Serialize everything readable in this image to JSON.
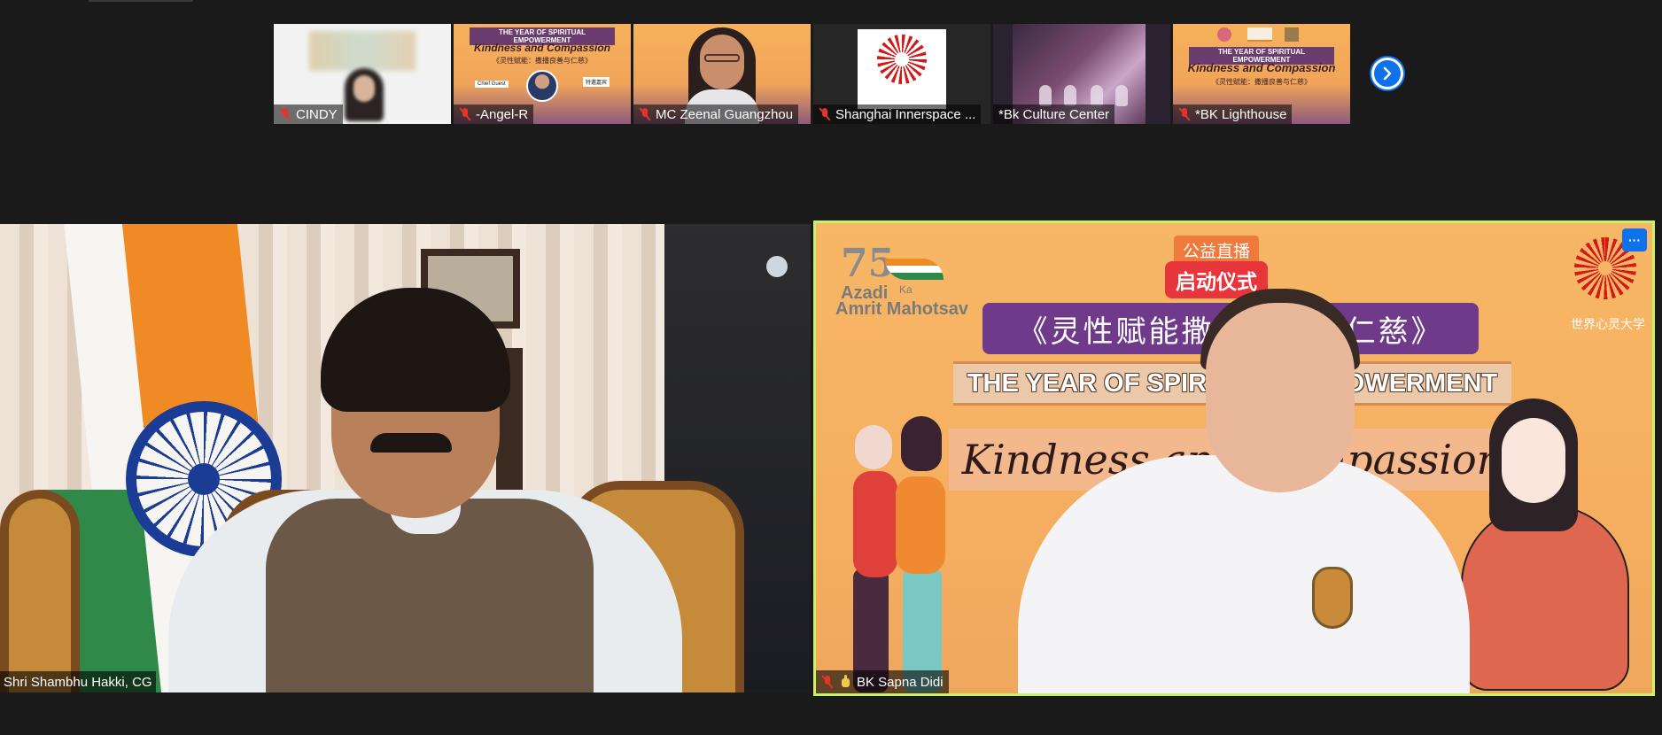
{
  "participants": [
    {
      "name": "CINDY",
      "muted": true
    },
    {
      "name": "-Angel-R",
      "muted": true
    },
    {
      "name": "MC Zeenal Guangzhou",
      "muted": true
    },
    {
      "name": "Shanghai Innerspace ...",
      "muted": true
    },
    {
      "name": "*Bk Culture Center",
      "muted": false
    },
    {
      "name": "*BK Lighthouse",
      "muted": true
    }
  ],
  "thumb_poster": {
    "title": "THE YEAR OF SPIRITUAL EMPOWERMENT",
    "subtitle": "Kindness and Compassion",
    "cn": "《灵性赋能：撒播良善与仁慈》",
    "chip_left": "Chief Guest",
    "chip_right": "特邀嘉宾"
  },
  "next_page_icon": "chevron-right-icon",
  "main_left": {
    "name": "Shri Shambhu Hakki, CG"
  },
  "main_right": {
    "name": "BK Sapna Didi",
    "muted": true,
    "hand_raised": true,
    "logo_75": "75",
    "logo_line1": "Azadi",
    "logo_ka": "Ka",
    "logo_line2": "Amrit Mahotsav",
    "tag_live": "公益直播",
    "tag_launch": "启动仪式",
    "banner_cn": "《灵性赋能撒播良善与仁慈》",
    "banner_en": "THE YEAR OF SPIRITUAL EMPOWERMENT",
    "kindness": "Kindness and Compassion",
    "university": "世界心灵大学",
    "more_label": "···"
  },
  "colors": {
    "accent": "#0e72ed",
    "active_speaker_border": "#c9f26b",
    "muted_red": "#e5342a"
  }
}
